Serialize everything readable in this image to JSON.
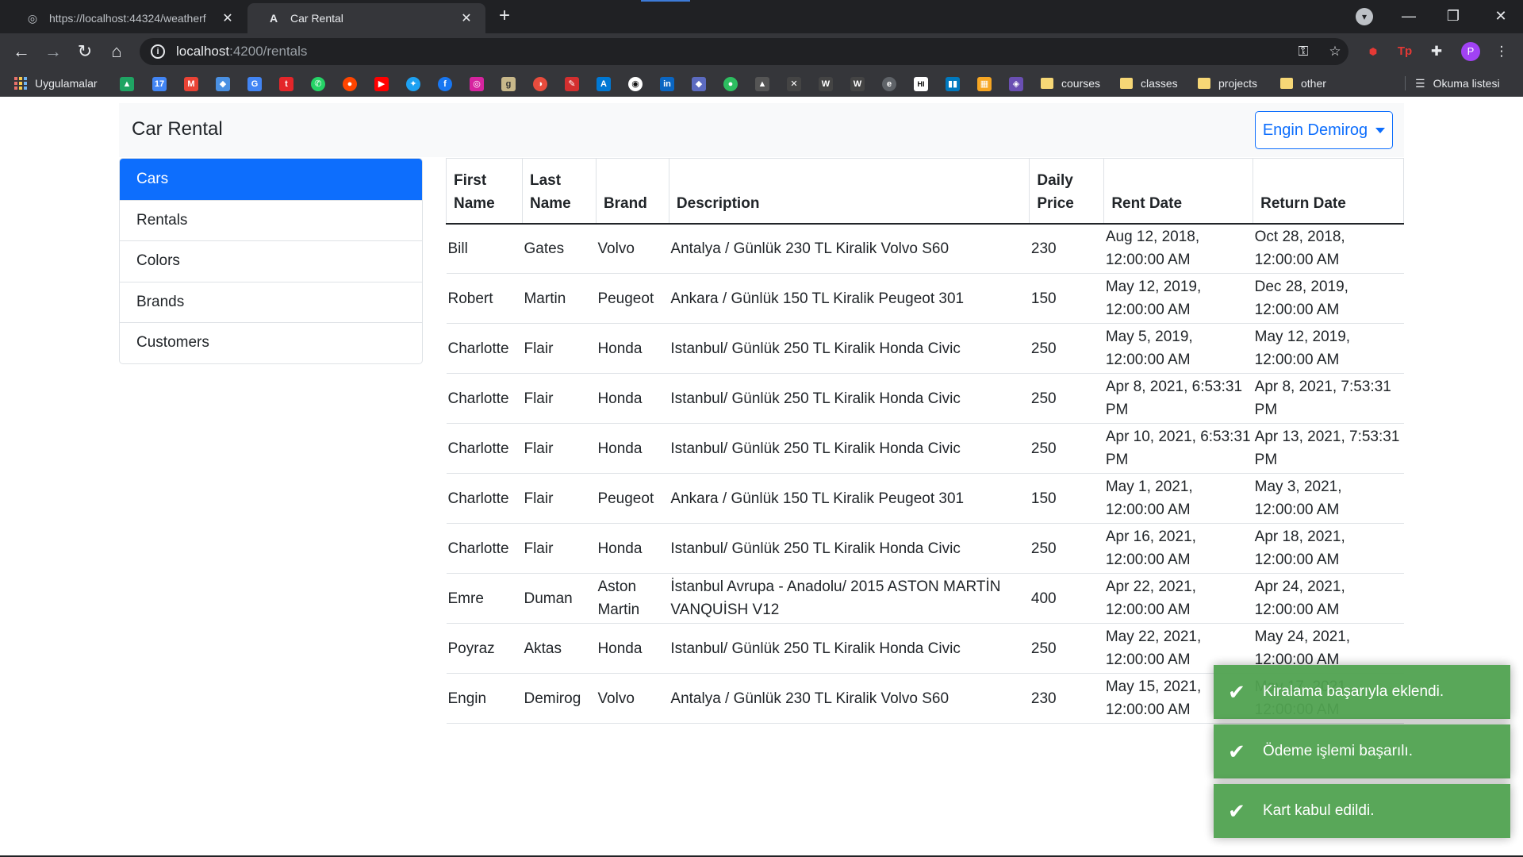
{
  "browser": {
    "tabs": [
      {
        "title": "https://localhost:44324/weatherf",
        "active": false
      },
      {
        "title": "Car Rental",
        "active": true
      }
    ],
    "url_host": "localhost",
    "url_path": ":4200/rentals",
    "bookmarks": {
      "apps_label": "Uygulamalar",
      "folders": [
        "courses",
        "classes",
        "projects",
        "other"
      ],
      "reading_list": "Okuma listesi"
    },
    "profile_initial": "P"
  },
  "navbar": {
    "brand": "Car Rental",
    "user_button": "Engin Demirog"
  },
  "sidebar": {
    "items": [
      {
        "label": "Cars",
        "active": true
      },
      {
        "label": "Rentals",
        "active": false
      },
      {
        "label": "Colors",
        "active": false
      },
      {
        "label": "Brands",
        "active": false
      },
      {
        "label": "Customers",
        "active": false
      }
    ]
  },
  "table": {
    "headers": {
      "first_name": [
        "First",
        "Name"
      ],
      "last_name": [
        "Last",
        "Name"
      ],
      "brand": "Brand",
      "description": "Description",
      "daily_price": [
        "Daily",
        "Price"
      ],
      "rent_date": "Rent Date",
      "return_date": "Return Date"
    },
    "rows": [
      [
        "Bill",
        "Gates",
        "Volvo",
        "Antalya / Günlük 230 TL Kiralik Volvo S60",
        "230",
        "Aug 12, 2018, 12:00:00 AM",
        "Oct 28, 2018, 12:00:00 AM"
      ],
      [
        "Robert",
        "Martin",
        "Peugeot",
        "Ankara / Günlük 150 TL Kiralik Peugeot 301",
        "150",
        "May 12, 2019, 12:00:00 AM",
        "Dec 28, 2019, 12:00:00 AM"
      ],
      [
        "Charlotte",
        "Flair",
        "Honda",
        "Istanbul/ Günlük 250 TL Kiralik Honda Civic",
        "250",
        "May 5, 2019, 12:00:00 AM",
        "May 12, 2019, 12:00:00 AM"
      ],
      [
        "Charlotte",
        "Flair",
        "Honda",
        "Istanbul/ Günlük 250 TL Kiralik Honda Civic",
        "250",
        "Apr 8, 2021, 6:53:31 PM",
        "Apr 8, 2021, 7:53:31 PM"
      ],
      [
        "Charlotte",
        "Flair",
        "Honda",
        "Istanbul/ Günlük 250 TL Kiralik Honda Civic",
        "250",
        "Apr 10, 2021, 6:53:31 PM",
        "Apr 13, 2021, 7:53:31 PM"
      ],
      [
        "Charlotte",
        "Flair",
        "Peugeot",
        "Ankara / Günlük 150 TL Kiralik Peugeot 301",
        "150",
        "May 1, 2021, 12:00:00 AM",
        "May 3, 2021, 12:00:00 AM"
      ],
      [
        "Charlotte",
        "Flair",
        "Honda",
        "Istanbul/ Günlük 250 TL Kiralik Honda Civic",
        "250",
        "Apr 16, 2021, 12:00:00 AM",
        "Apr 18, 2021, 12:00:00 AM"
      ],
      [
        "Emre",
        "Duman",
        "Aston Martin",
        "İstanbul Avrupa - Anadolu/ 2015 ASTON MARTİN VANQUİSH V12",
        "400",
        "Apr 22, 2021, 12:00:00 AM",
        "Apr 24, 2021, 12:00:00 AM"
      ],
      [
        "Poyraz",
        "Aktas",
        "Honda",
        "Istanbul/ Günlük 250 TL Kiralik Honda Civic",
        "250",
        "May 22, 2021, 12:00:00 AM",
        "May 24, 2021, 12:00:00 AM"
      ],
      [
        "Engin",
        "Demirog",
        "Volvo",
        "Antalya / Günlük 230 TL Kiralik Volvo S60",
        "230",
        "May 15, 2021, 12:00:00 AM",
        "May 17, 2021, 12:00:00 AM"
      ]
    ]
  },
  "toasts": [
    "Kiralama başarıyla eklendi.",
    "Ödeme işlemi başarılı.",
    "Kart kabul edildi."
  ],
  "colors": {
    "primary": "#0d6efd",
    "toast_success": "#51a351",
    "chrome_dark": "#202124",
    "chrome_toolbar": "#35363a"
  }
}
